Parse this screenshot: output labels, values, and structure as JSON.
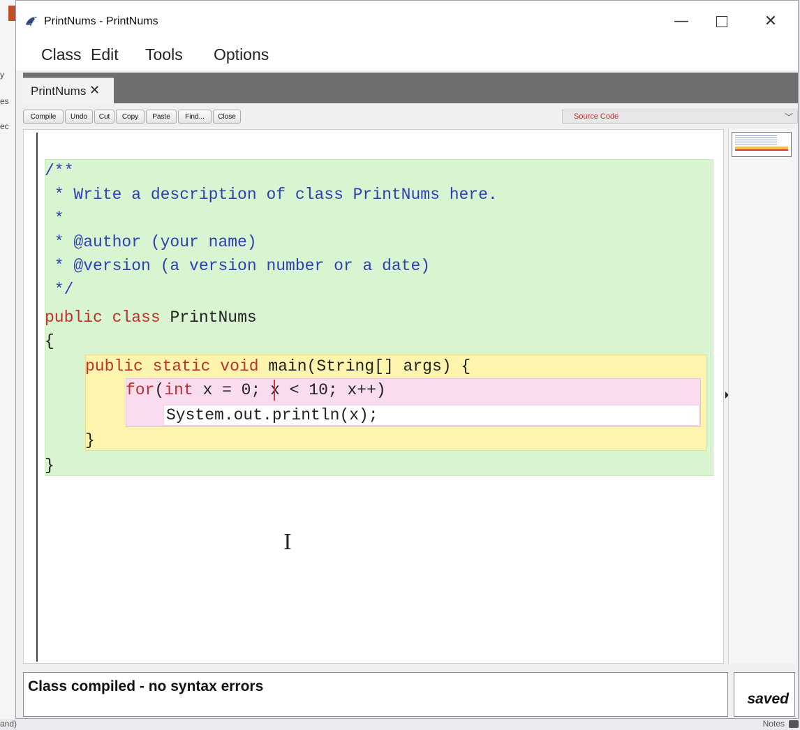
{
  "window": {
    "title": "PrintNums - PrintNums"
  },
  "menu": [
    "Class",
    "Edit",
    "Tools",
    "Options"
  ],
  "tab": {
    "label": "PrintNums",
    "close_glyph": "✕"
  },
  "toolbar": {
    "buttons": [
      "Compile",
      "Undo",
      "Cut",
      "Copy",
      "Paste",
      "Find...",
      "Close"
    ]
  },
  "view_selector": {
    "selected": "Source Code"
  },
  "code": {
    "comment": [
      "/**",
      " * Write a description of class PrintNums here.",
      " *",
      " * @author (your name)",
      " * @version (a version number or a date)",
      " */"
    ],
    "class_decl": {
      "kw1": "public",
      "kw2": "class",
      "name": "PrintNums"
    },
    "open_brace": "{",
    "method_decl": {
      "kw1": "public",
      "kw2": "static",
      "kw3": "void",
      "rest": "main(String[] args)",
      "brace": "{"
    },
    "for_line": {
      "kw_for": "for",
      "paren": "(",
      "kw_int": "int",
      "rest": " x = 0; x < 10; x++)"
    },
    "stmt": "System.out.println(x);",
    "method_close": "}",
    "class_close": "}"
  },
  "status": {
    "message": "Class compiled - no syntax errors",
    "saved": "saved"
  },
  "background": {
    "bottom_left": "and)",
    "bottom_right": "Notes",
    "left_fragments": [
      "y",
      "es",
      "ec"
    ]
  },
  "colors": {
    "class_scope": "#d8f4d0",
    "method_scope": "#fdf4ae",
    "for_scope": "#fadcf0",
    "comment": "#2c3fb5",
    "keyword": "#c0302c"
  },
  "icons": {
    "app": "bluej-bird-icon",
    "minimize": "minimize-icon",
    "maximize": "maximize-icon",
    "close": "close-icon"
  }
}
